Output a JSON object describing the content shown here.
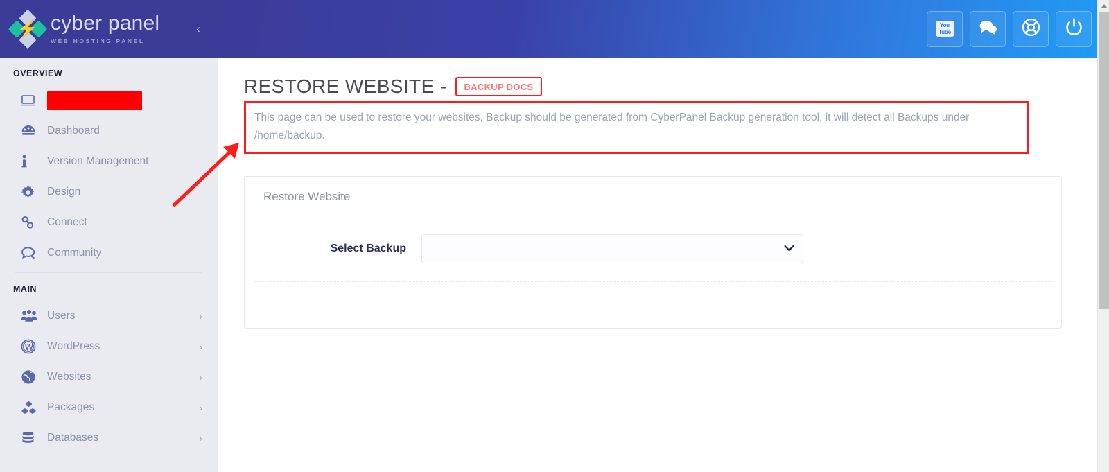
{
  "brand": {
    "name": "cyber panel",
    "tagline": "WEB HOSTING PANEL",
    "logo_icon": "cyberpanel-diamond-bolt-logo",
    "collapse_icon": "chevron-left-icon",
    "header_gradient_from": "#3b3b98",
    "header_gradient_to": "#1f9bf5",
    "sidebar_bg": "#e9ebf0"
  },
  "topbar": {
    "buttons": [
      {
        "name": "youtube-button",
        "icon": "youtube-icon",
        "label_top": "You",
        "label_bottom": "Tube"
      },
      {
        "name": "chat-button",
        "icon": "chat-bubbles-icon"
      },
      {
        "name": "support-button",
        "icon": "life-buoy-icon"
      },
      {
        "name": "power-button",
        "icon": "power-icon"
      }
    ]
  },
  "sidebar": {
    "sections": [
      {
        "label": "OVERVIEW",
        "items": [
          {
            "label": "",
            "icon": "monitor-icon",
            "redacted": true,
            "caret": false
          },
          {
            "label": "Dashboard",
            "icon": "dashboard-gauge-icon",
            "caret": false
          },
          {
            "label": "Version Management",
            "icon": "info-icon",
            "caret": false
          },
          {
            "label": "Design",
            "icon": "gear-icon",
            "caret": false
          },
          {
            "label": "Connect",
            "icon": "link-icon",
            "caret": false
          },
          {
            "label": "Community",
            "icon": "comment-icon",
            "caret": false
          }
        ]
      },
      {
        "label": "MAIN",
        "items": [
          {
            "label": "Users",
            "icon": "users-icon",
            "caret": true
          },
          {
            "label": "WordPress",
            "icon": "wordpress-icon",
            "caret": true
          },
          {
            "label": "Websites",
            "icon": "globe-icon",
            "caret": true
          },
          {
            "label": "Packages",
            "icon": "boxes-icon",
            "caret": true
          },
          {
            "label": "Databases",
            "icon": "database-icon",
            "caret": true
          }
        ]
      }
    ]
  },
  "page": {
    "title": "RESTORE WEBSITE -",
    "docs_badge": "BACKUP DOCS",
    "description": "This page can be used to restore your websites, Backup should be generated from CyberPanel Backup generation tool, it will detect all Backups under /home/backup.",
    "annotation": {
      "highlight_color": "#fc1d1d",
      "arrow_icon": "arrow-up-right-annotation"
    }
  },
  "card": {
    "heading": "Restore Website",
    "form": {
      "select_backup_label": "Select Backup",
      "select_backup_value": "",
      "select_backup_options": [
        ""
      ],
      "select_caret_icon": "chevron-down-icon"
    }
  },
  "scrollbar": {
    "up_arrow_icon": "scroll-up-arrow-icon",
    "thumb_name": "vertical-scroll-thumb"
  }
}
